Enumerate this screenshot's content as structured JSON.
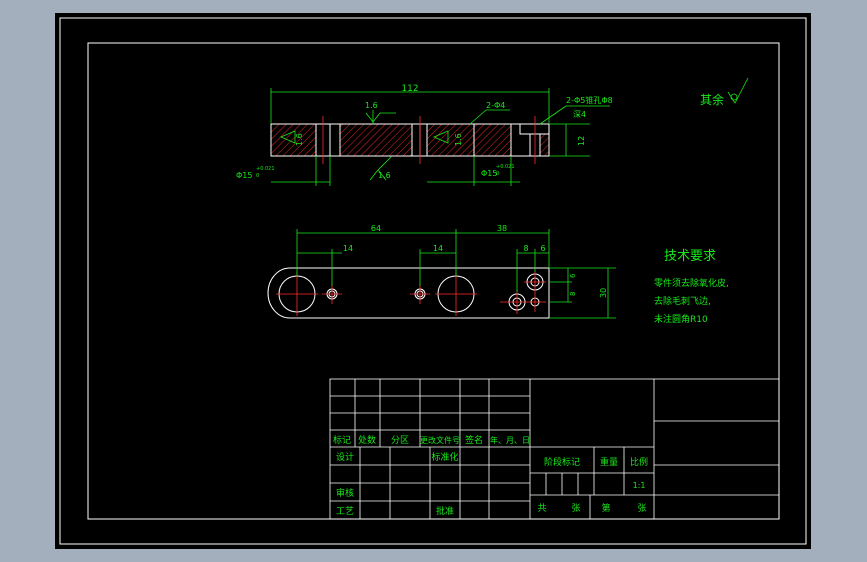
{
  "colors": {
    "background": "#a4afbe",
    "sheet": "#000000",
    "outline": "#ffffff",
    "annotation": "#18e818",
    "centerline": "#ff2a2a",
    "hatch": "#ff2a2a"
  },
  "drawing": {
    "top_view": {
      "overall_length": "112",
      "roughness_center": "1.6",
      "roughness_left": "1.6",
      "roughness_mid": "1.6",
      "roughness_bottom": "1.6",
      "hole_label_2phi4": "2-Φ4",
      "pin_holes_label": "2-Φ5锥孔Φ8",
      "depth_label": "深4",
      "height_dim": "12",
      "bore_left_main": "Φ15",
      "bore_left_tol": "+0.021",
      "bore_left_low": "0",
      "bore_right_main": "Φ15",
      "bore_right_tol": "+0.021",
      "bore_right_low": "0"
    },
    "front_view": {
      "dim_64": "64",
      "dim_38": "38",
      "dim_14_left": "14",
      "dim_14_mid": "14",
      "dim_8_top": "8",
      "dim_6_top": "6",
      "dim_6_side": "6",
      "dim_8_side": "8",
      "dim_30": "30"
    },
    "roughness_other": "其余",
    "tech_title": "技术要求",
    "tech_notes": [
      "零件须去除氧化皮,",
      "去除毛刺飞边,",
      "未注圆角R10"
    ]
  },
  "title_block": {
    "col_mark": "标记",
    "col_count": "处数",
    "col_zone": "分区",
    "col_docno": "更改文件号",
    "col_sign": "签名",
    "col_date": "年、月、日",
    "design": "设计",
    "standard": "标准化",
    "review": "审核",
    "process": "工艺",
    "approve": "批准",
    "stage_mark": "阶段标记",
    "weight": "重量",
    "scale": "比例",
    "scale_value": "1:1",
    "total": "共",
    "sheet_label": "张",
    "page_label": "第",
    "page_unit": "张"
  }
}
